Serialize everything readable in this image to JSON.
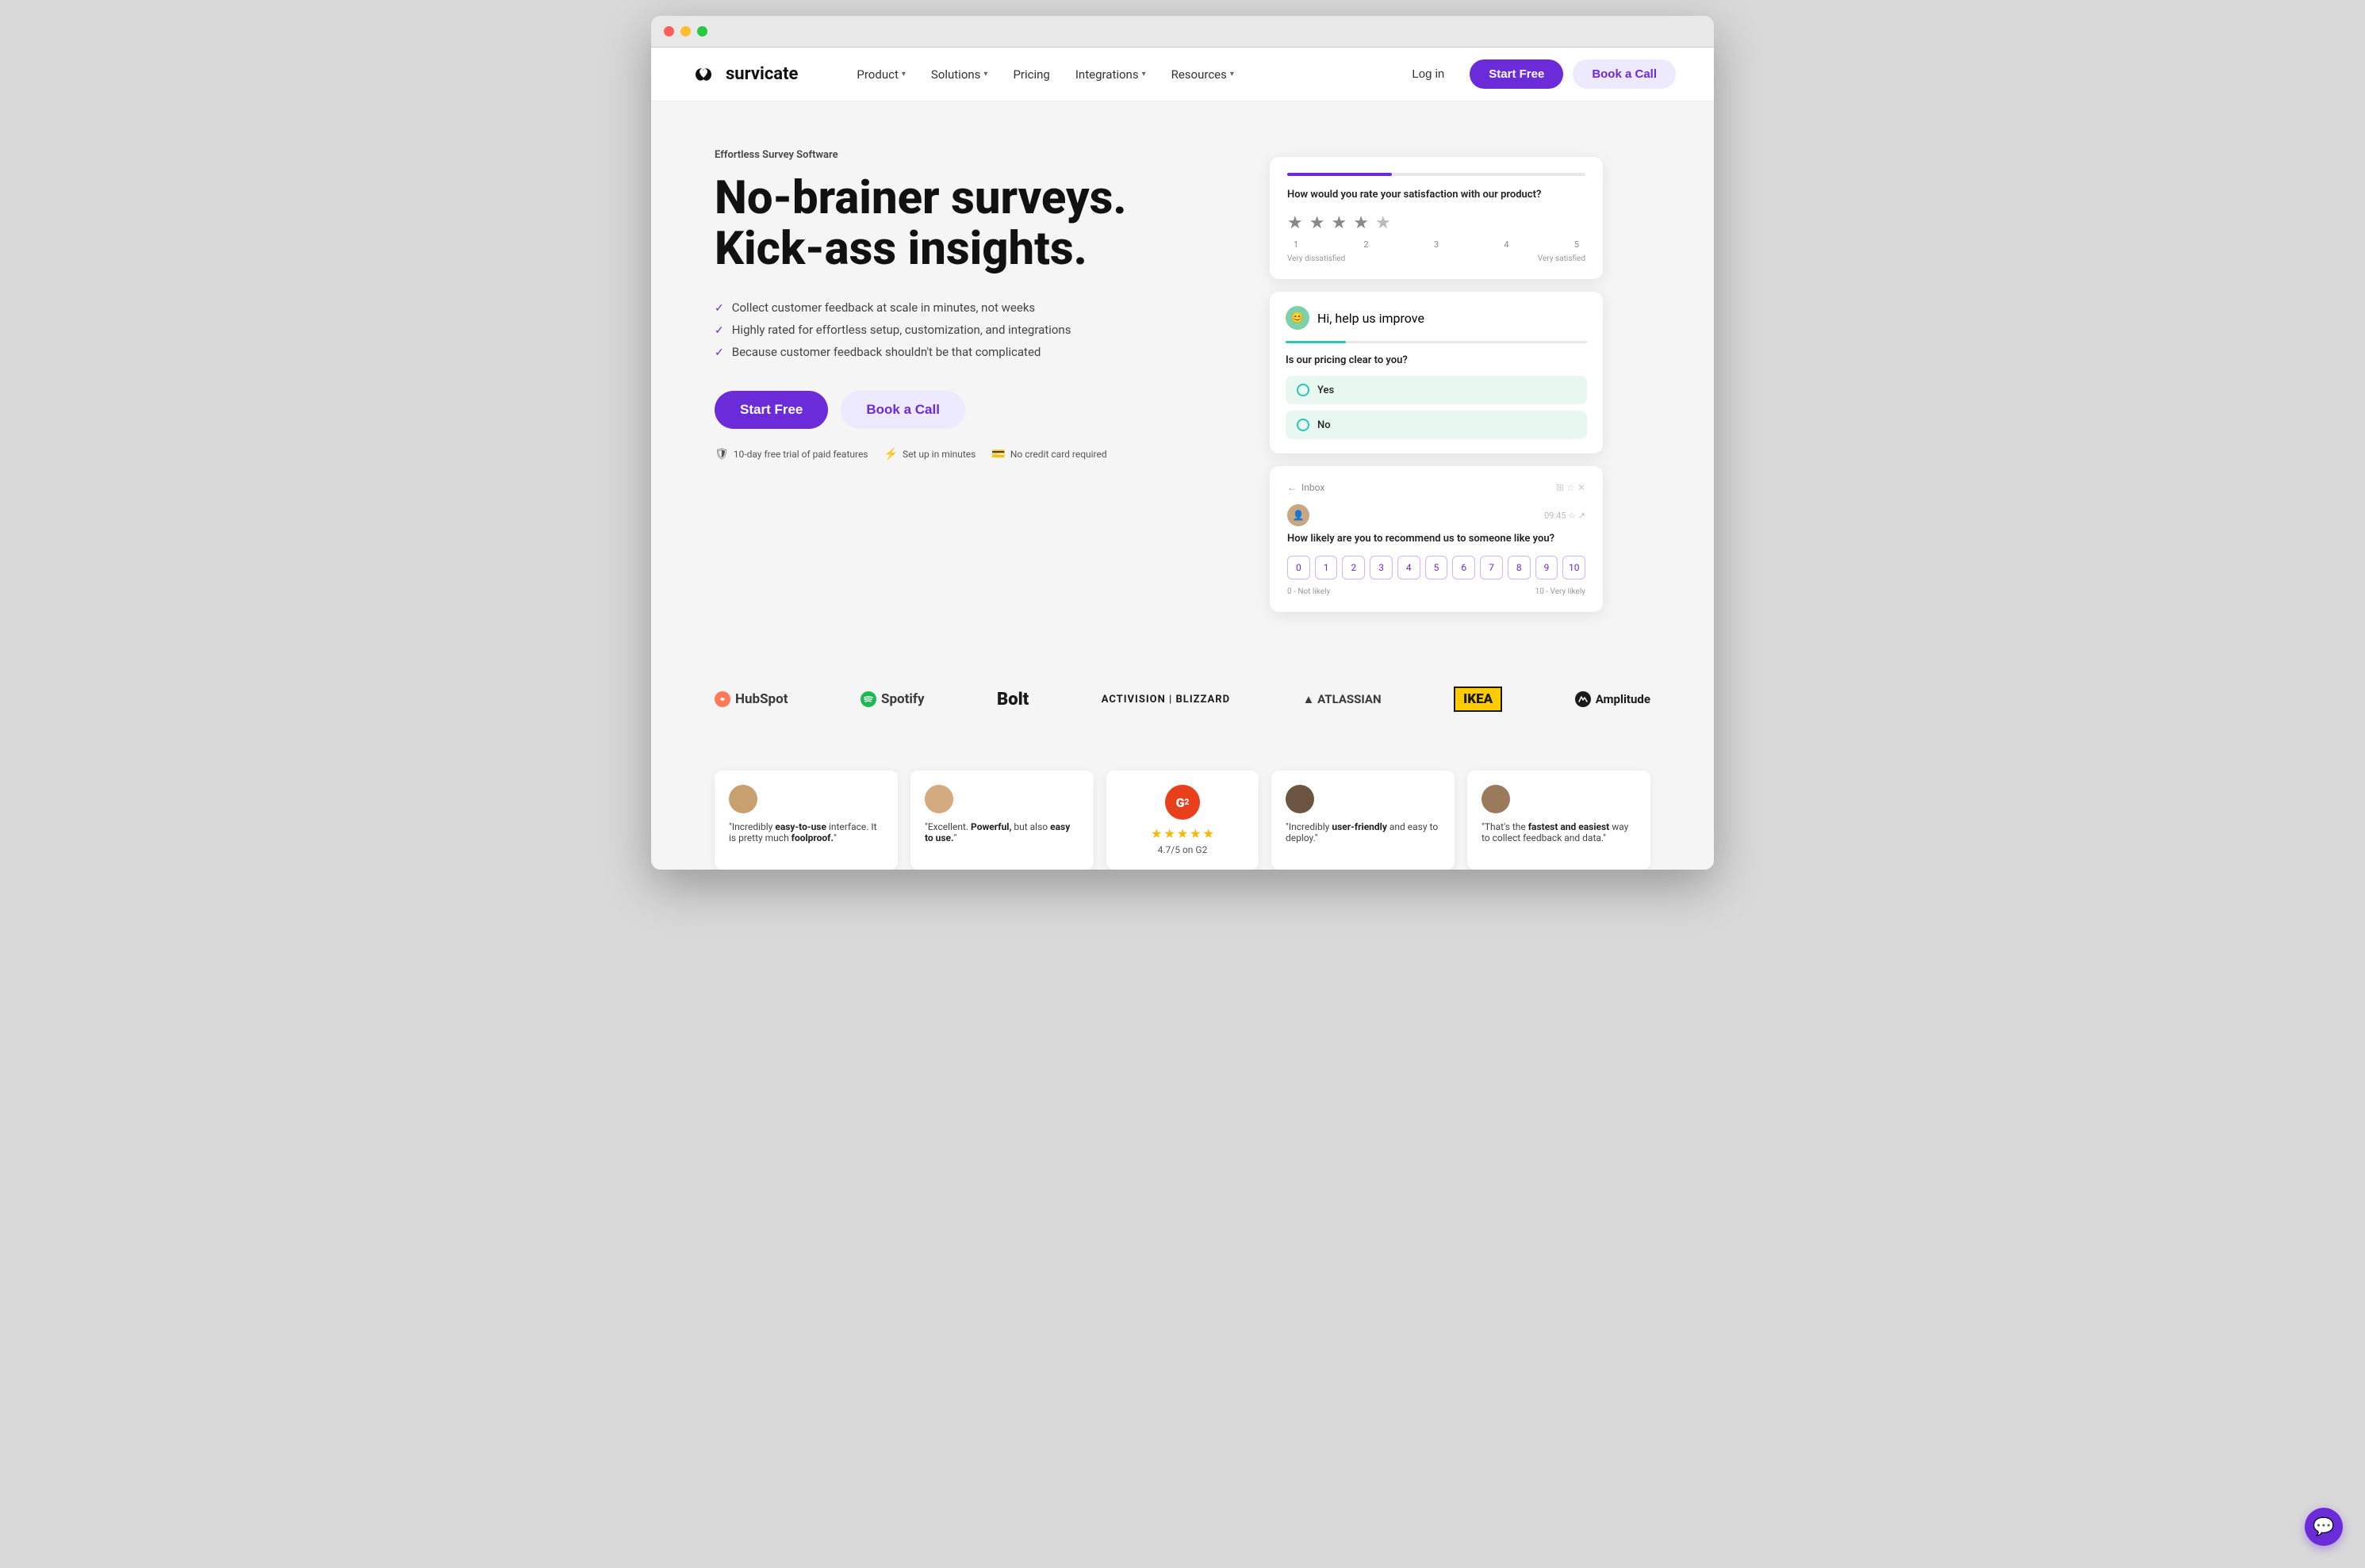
{
  "browser": {
    "dots": [
      "red",
      "yellow",
      "green"
    ]
  },
  "navbar": {
    "logo_text": "survicate",
    "nav_items": [
      {
        "label": "Product",
        "has_chevron": true
      },
      {
        "label": "Solutions",
        "has_chevron": true
      },
      {
        "label": "Pricing",
        "has_chevron": false
      },
      {
        "label": "Integrations",
        "has_chevron": true
      },
      {
        "label": "Resources",
        "has_chevron": true
      }
    ],
    "login_label": "Log in",
    "start_free_label": "Start Free",
    "book_call_label": "Book a Call"
  },
  "hero": {
    "label": "Effortless Survey Software",
    "title_line1": "No-brainer surveys.",
    "title_line2": "Kick-ass insights.",
    "features": [
      "Collect customer feedback at scale in minutes, not weeks",
      "Highly rated for effortless setup, customization, and integrations",
      "Because customer feedback shouldn't be that complicated"
    ],
    "cta_start": "Start Free",
    "cta_book": "Book a Call",
    "meta": [
      "10-day free trial of paid features",
      "Set up in minutes",
      "No credit card required"
    ]
  },
  "survey_card_rating": {
    "progress_pct": 35,
    "question": "How would you rate your satisfaction with our product?",
    "stars": [
      1,
      2,
      3,
      4,
      5
    ],
    "filled_stars": 4,
    "label_low": "Very dissatisfied",
    "label_high": "Very satisfied"
  },
  "survey_card_pricing": {
    "header_text": "Hi, help us improve",
    "progress_pct": 20,
    "question": "Is our pricing clear to you?",
    "options": [
      "Yes",
      "No"
    ]
  },
  "survey_card_nps": {
    "inbox_label": "Inbox",
    "question": "How likely are you to recommend us to someone like you?",
    "scale": [
      0,
      1,
      2,
      3,
      4,
      5,
      6,
      7,
      8,
      9,
      10
    ],
    "label_low": "0 - Not likely",
    "label_high": "10 - Very likely"
  },
  "logos": [
    {
      "name": "HubSpot",
      "class": "logo-hubspot"
    },
    {
      "name": "Spotify",
      "class": "logo-spotify"
    },
    {
      "name": "Bolt",
      "class": "logo-bolt"
    },
    {
      "name": "Activision | Blizzard",
      "class": "logo-activision"
    },
    {
      "name": "▲ ATLASSIAN",
      "class": "logo-atlassian"
    },
    {
      "name": "IKEA",
      "class": "logo-ikea"
    },
    {
      "name": "Amplitude",
      "class": "logo-amplitude"
    }
  ],
  "testimonials": [
    {
      "text": "\"Incredibly easy-to-use interface. It is pretty much foolproof.\"",
      "emphasis": [
        "easy-to-use",
        "foolproof"
      ]
    },
    {
      "text": "\"Excellent. Powerful, but also easy to use.\"",
      "emphasis": [
        "Powerful",
        "easy to use"
      ]
    },
    {
      "g2": true,
      "rating": "4.7/5 on G2"
    },
    {
      "text": "\"Incredibly user-friendly and easy to deploy.\"",
      "emphasis": [
        "user-friendly"
      ]
    },
    {
      "text": "\"That's the fastest and easiest way to collect feedback and data.\"",
      "emphasis": [
        "fastest and easiest"
      ]
    }
  ]
}
